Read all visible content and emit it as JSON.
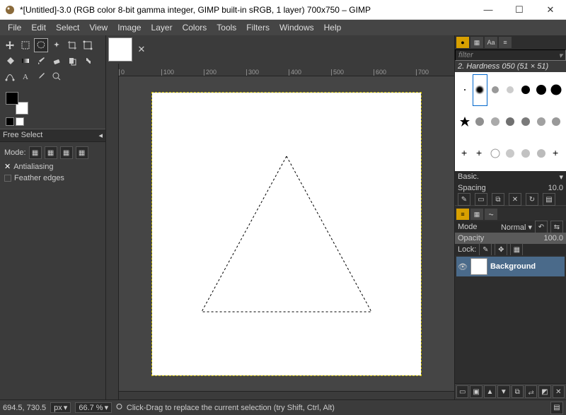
{
  "window": {
    "title": "*[Untitled]-3.0 (RGB color 8-bit gamma integer, GIMP built-in sRGB, 1 layer) 700x750 – GIMP",
    "minimize": "—",
    "maximize": "☐",
    "close": "✕"
  },
  "menubar": [
    "File",
    "Edit",
    "Select",
    "View",
    "Image",
    "Layer",
    "Colors",
    "Tools",
    "Filters",
    "Windows",
    "Help"
  ],
  "tool_options": {
    "header": "Free Select",
    "mode_label": "Mode:",
    "antialiasing_label": "Antialiasing",
    "feather_label": "Feather edges"
  },
  "canvas": {
    "ruler_ticks": [
      "0",
      "100",
      "200",
      "300",
      "400",
      "500",
      "600",
      "700"
    ]
  },
  "brushes": {
    "filter_placeholder": "filter",
    "selected_label": "2. Hardness 050 (51 × 51)",
    "preset_label": "Basic.",
    "spacing_label": "Spacing",
    "spacing_value": "10.0"
  },
  "layers": {
    "mode_label": "Mode",
    "mode_value": "Normal",
    "opacity_label": "Opacity",
    "opacity_value": "100.0",
    "lock_label": "Lock:",
    "layer_name": "Background"
  },
  "statusbar": {
    "coords": "694.5, 730.5",
    "unit": "px",
    "zoom": "66.7 %",
    "hint": "Click-Drag to replace the current selection (try Shift, Ctrl, Alt)"
  }
}
